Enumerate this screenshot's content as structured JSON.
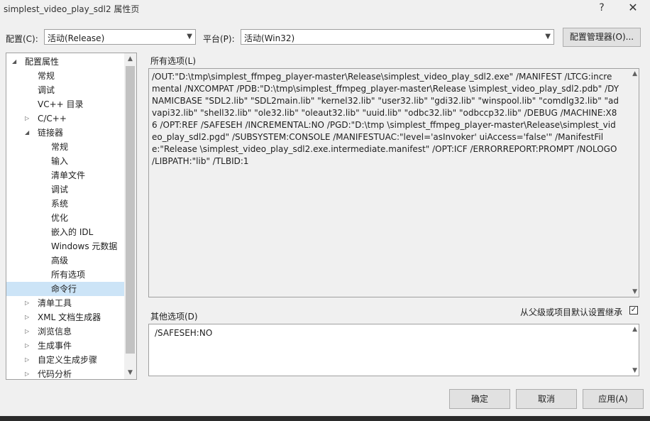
{
  "window": {
    "title": "simplest_video_play_sdl2 属性页",
    "help_glyph": "?",
    "close_glyph": "✕"
  },
  "config": {
    "label": "配置(C):",
    "value": "活动(Release)"
  },
  "platform": {
    "label": "平台(P):",
    "value": "活动(Win32)"
  },
  "config_manager_button": "配置管理器(O)...",
  "tree": {
    "items": [
      {
        "label": "配置属性",
        "level": 0,
        "expander": "◢"
      },
      {
        "label": "常规",
        "level": 1,
        "expander": ""
      },
      {
        "label": "调试",
        "level": 1,
        "expander": ""
      },
      {
        "label": "VC++ 目录",
        "level": 1,
        "expander": ""
      },
      {
        "label": "C/C++",
        "level": 1,
        "expander": "▷"
      },
      {
        "label": "链接器",
        "level": 1,
        "expander": "◢"
      },
      {
        "label": "常规",
        "level": 2,
        "expander": ""
      },
      {
        "label": "输入",
        "level": 2,
        "expander": ""
      },
      {
        "label": "清单文件",
        "level": 2,
        "expander": ""
      },
      {
        "label": "调试",
        "level": 2,
        "expander": ""
      },
      {
        "label": "系统",
        "level": 2,
        "expander": ""
      },
      {
        "label": "优化",
        "level": 2,
        "expander": ""
      },
      {
        "label": "嵌入的 IDL",
        "level": 2,
        "expander": ""
      },
      {
        "label": "Windows 元数据",
        "level": 2,
        "expander": ""
      },
      {
        "label": "高级",
        "level": 2,
        "expander": ""
      },
      {
        "label": "所有选项",
        "level": 2,
        "expander": ""
      },
      {
        "label": "命令行",
        "level": 2,
        "expander": "",
        "selected": true
      },
      {
        "label": "清单工具",
        "level": 1,
        "expander": "▷"
      },
      {
        "label": "XML 文档生成器",
        "level": 1,
        "expander": "▷"
      },
      {
        "label": "浏览信息",
        "level": 1,
        "expander": "▷"
      },
      {
        "label": "生成事件",
        "level": 1,
        "expander": "▷"
      },
      {
        "label": "自定义生成步骤",
        "level": 1,
        "expander": "▷"
      },
      {
        "label": "代码分析",
        "level": 1,
        "expander": "▷"
      }
    ]
  },
  "all_options": {
    "label": "所有选项(L)",
    "text": "/OUT:\"D:\\tmp\\simplest_ffmpeg_player-master\\Release\\simplest_video_play_sdl2.exe\" /MANIFEST /LTCG:incremental /NXCOMPAT /PDB:\"D:\\tmp\\simplest_ffmpeg_player-master\\Release \\simplest_video_play_sdl2.pdb\" /DYNAMICBASE \"SDL2.lib\" \"SDL2main.lib\" \"kernel32.lib\" \"user32.lib\" \"gdi32.lib\" \"winspool.lib\" \"comdlg32.lib\" \"advapi32.lib\" \"shell32.lib\" \"ole32.lib\" \"oleaut32.lib\" \"uuid.lib\" \"odbc32.lib\" \"odbccp32.lib\" /DEBUG /MACHINE:X86 /OPT:REF /SAFESEH /INCREMENTAL:NO /PGD:\"D:\\tmp \\simplest_ffmpeg_player-master\\Release\\simplest_video_play_sdl2.pgd\" /SUBSYSTEM:CONSOLE /MANIFESTUAC:\"level='asInvoker' uiAccess='false'\" /ManifestFile:\"Release \\simplest_video_play_sdl2.exe.intermediate.manifest\" /OPT:ICF /ERRORREPORT:PROMPT /NOLOGO /LIBPATH:\"lib\" /TLBID:1"
  },
  "other_options": {
    "label": "其他选项(D)",
    "value": "/SAFESEH:NO",
    "inherit_label": "从父级或项目默认设置继承",
    "inherit_checked": true,
    "check_glyph": "✓"
  },
  "buttons": {
    "ok": "确定",
    "cancel": "取消",
    "apply": "应用(A)"
  }
}
